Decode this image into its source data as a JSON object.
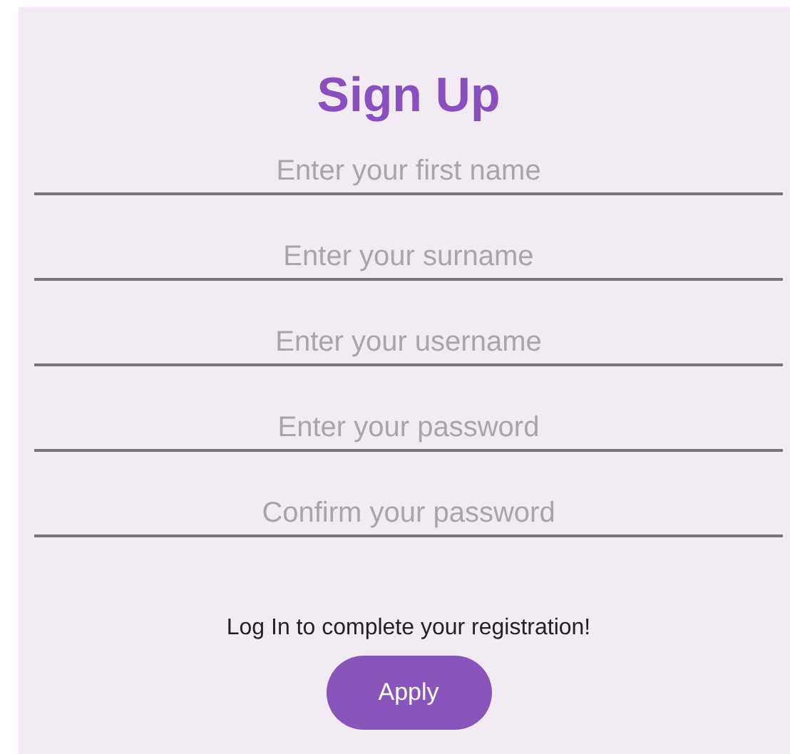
{
  "title": "Sign Up",
  "fields": [
    {
      "placeholder": "Enter your first name"
    },
    {
      "placeholder": "Enter your surname"
    },
    {
      "placeholder": "Enter your username"
    },
    {
      "placeholder": "Enter your password"
    },
    {
      "placeholder": "Confirm your password"
    }
  ],
  "message": "Log In to complete your registration!",
  "button": "Apply"
}
